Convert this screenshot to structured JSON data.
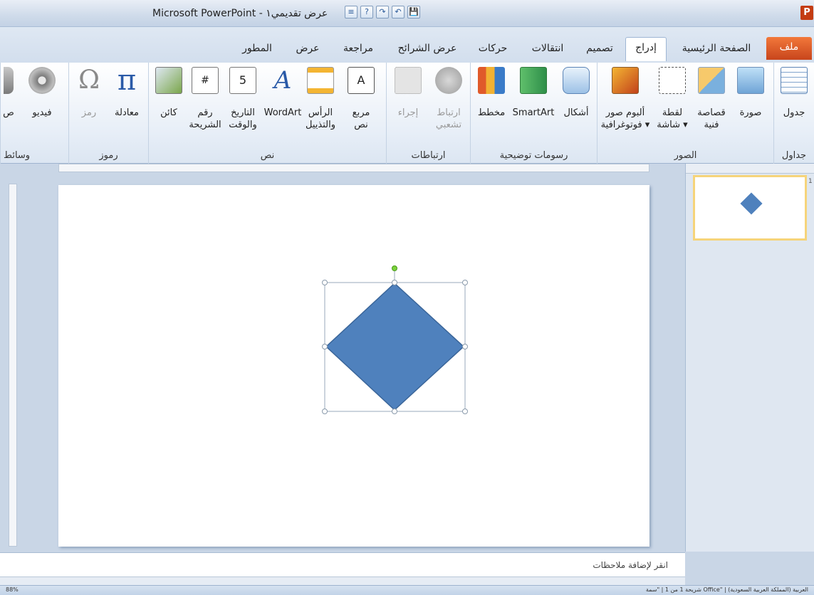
{
  "window": {
    "title": "Microsoft PowerPoint - عرض تقديمي١",
    "app_icon_letter": "P"
  },
  "qat": [
    "P",
    "💾",
    "↶",
    "↷",
    "?",
    "≡"
  ],
  "tabs": [
    {
      "label": "ملف",
      "active": false
    },
    {
      "label": "الصفحة الرئيسية",
      "active": false
    },
    {
      "label": "إدراج",
      "active": true
    },
    {
      "label": "تصميم",
      "active": false
    },
    {
      "label": "انتقالات",
      "active": false
    },
    {
      "label": "حركات",
      "active": false
    },
    {
      "label": "عرض الشرائح",
      "active": false
    },
    {
      "label": "مراجعة",
      "active": false
    },
    {
      "label": "عرض",
      "active": false
    },
    {
      "label": "المطور",
      "active": false
    }
  ],
  "ribbon": {
    "groups": {
      "tables": "جداول",
      "images": "الصور",
      "illustrations": "رسومات توضيحية",
      "links": "ارتباطات",
      "text": "نص",
      "symbols": "رموز",
      "media": "وسائط"
    },
    "buttons": {
      "table": "جدول",
      "picture": "صورة",
      "clipart_1": "قصاصة",
      "clipart_2": "فنية",
      "screenshot_1": "لقطة",
      "screenshot_2": "شاشة ▾",
      "album_1": "ألبوم صور",
      "album_2": "فوتوغرافية ▾",
      "shapes": "أشكال",
      "smartart": "SmartArt",
      "chart": "مخطط",
      "hyperlink_1": "ارتباط",
      "hyperlink_2": "تشعبي",
      "action": "إجراء",
      "textbox_1": "مربع",
      "textbox_2": "نص",
      "header_1": "الرأس",
      "header_2": "والتذييل",
      "wordart": "WordArt",
      "datetime_1": "التاريخ",
      "datetime_2": "والوقت",
      "slidenum_1": "رقم",
      "slidenum_2": "الشريحة",
      "object": "كائن",
      "equation": "معادلة",
      "symbol": "رمز",
      "video": "فيديو",
      "audio": "ص"
    }
  },
  "slide_pane": {
    "thumb_number": "1"
  },
  "notes": {
    "placeholder": "انقر لإضافة ملاحظات"
  },
  "status": {
    "left": "88%",
    "right": "شريحة 1 من 1   |   \"سمة Office\"   |   العربية (المملكة العربية السعودية)"
  },
  "colors": {
    "shape_fill": "#4f81bd",
    "file_tab": "#d2541e",
    "thumb_border": "#f6d47a"
  }
}
